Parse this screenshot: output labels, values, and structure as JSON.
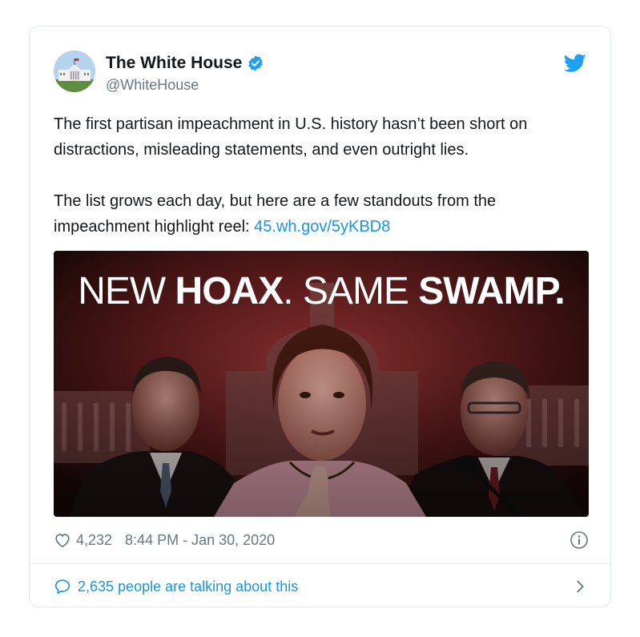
{
  "tweet": {
    "author_name": "The White House",
    "handle": "@WhiteHouse",
    "paragraph1": "The first partisan impeachment in U.S. history hasn’t been short on distractions, misleading statements, and even outright lies.",
    "paragraph2_text": "The list grows each day, but here are a few standouts from the impeachment highlight reel: ",
    "link": "45.wh.gov/5yKBD8",
    "image_headline_part1": "NEW ",
    "image_headline_part2": "HOAX",
    "image_headline_part3": ". SAME ",
    "image_headline_part4": "SWAMP.",
    "likes": "4,232",
    "timestamp": "8:44 PM - Jan 30, 2020",
    "talking": "2,635 people are talking about this"
  },
  "colors": {
    "twitter_blue": "#1b95e0",
    "verified_blue": "#1da1f2",
    "secondary_text": "#657786",
    "border": "#e1e8ed"
  },
  "icons": [
    "verified-badge-icon",
    "twitter-bird-icon",
    "heart-icon",
    "info-icon",
    "speech-bubble-icon",
    "chevron-right-icon"
  ]
}
